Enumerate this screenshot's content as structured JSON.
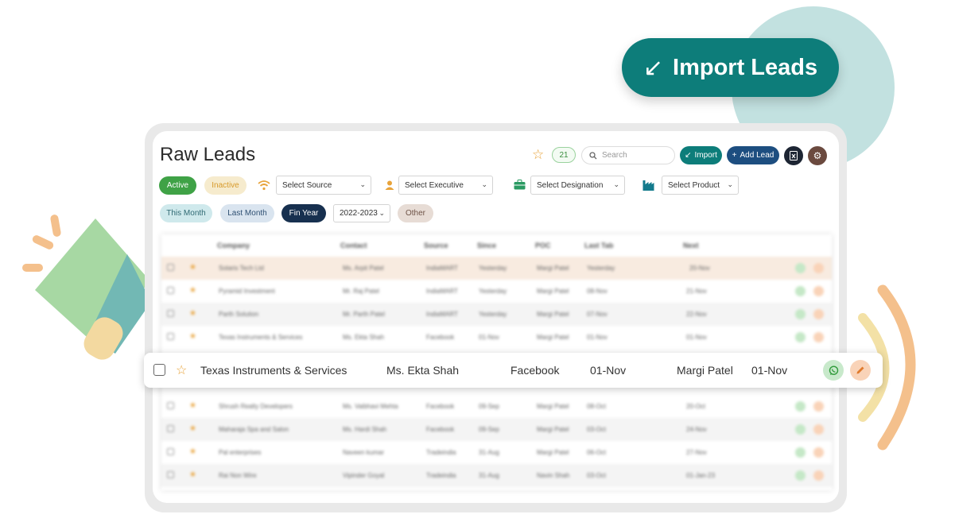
{
  "hero": {
    "label": "Import Leads",
    "arrow": "↙"
  },
  "header": {
    "title": "Raw Leads",
    "star_count": "21",
    "search_placeholder": "Search",
    "import_label": "Import",
    "import_arrow": "↙",
    "add_lead_label": "Add Lead",
    "add_lead_plus": "+"
  },
  "filters": {
    "status": [
      "Active",
      "Inactive"
    ],
    "source_select": "Select Source",
    "executive_select": "Select Executive",
    "designation_select": "Select Designation",
    "product_select": "Select Product",
    "periods": [
      "This Month",
      "Last Month",
      "Fin Year"
    ],
    "year_select": "2022-2023",
    "other_label": "Other"
  },
  "table": {
    "columns": [
      "Company",
      "Contact",
      "Source",
      "Since",
      "POC",
      "Last Tab",
      "Next"
    ],
    "rows": [
      [
        "Solaris Tech Ltd",
        "Ms. Arpit Patel",
        "IndiaMART",
        "Yesterday",
        "Margi Patel",
        "Yesterday",
        "20-Nov"
      ],
      [
        "Pyramid Investment",
        "Mr. Raj Patel",
        "IndiaMART",
        "Yesterday",
        "Margi Patel",
        "08-Nov",
        "21-Nov"
      ],
      [
        "Parth Solution",
        "Mr. Parth Patel",
        "IndiaMART",
        "Yesterday",
        "Margi Patel",
        "07-Nov",
        "22-Nov"
      ],
      [
        "Texas Instruments & Services",
        "Ms. Ekta Shah",
        "Facebook",
        "01-Nov",
        "Margi Patel",
        "01-Nov",
        "01-Nov"
      ],
      [
        "Shrush Realty Developers",
        "Ms. Vaibhavi Mehta",
        "Facebook",
        "09-Sep",
        "Margi Patel",
        "08-Oct",
        "20-Oct"
      ],
      [
        "Maharaja Spa and Salon",
        "Ms. Hardi Shah",
        "Facebook",
        "09-Sep",
        "Margi Patel",
        "03-Oct",
        "24-Nov"
      ],
      [
        "Pal enterprises",
        "Naveen kumar",
        "Tradeindia",
        "31-Aug",
        "Margi Patel",
        "06-Oct",
        "27-Nov"
      ],
      [
        "Rai Non Wire",
        "Vipinder Goyal",
        "Tradeindia",
        "31-Aug",
        "Navin Shah",
        "03-Oct",
        "01-Jan-23"
      ]
    ]
  },
  "highlighted_row": {
    "company": "Texas Instruments & Services",
    "contact": "Ms. Ekta Shah",
    "source": "Facebook",
    "since": "01-Nov",
    "poc": "Margi Patel",
    "last_tab": "01-Nov"
  },
  "icons": {
    "source": "wifi-icon",
    "executive": "person-icon",
    "designation": "briefcase-icon",
    "product": "factory-icon"
  },
  "colors": {
    "brand_teal": "#0d7d7a",
    "brand_blue": "#1d4e80",
    "active_green": "#3fa246",
    "star_orange": "#e8a33a"
  }
}
